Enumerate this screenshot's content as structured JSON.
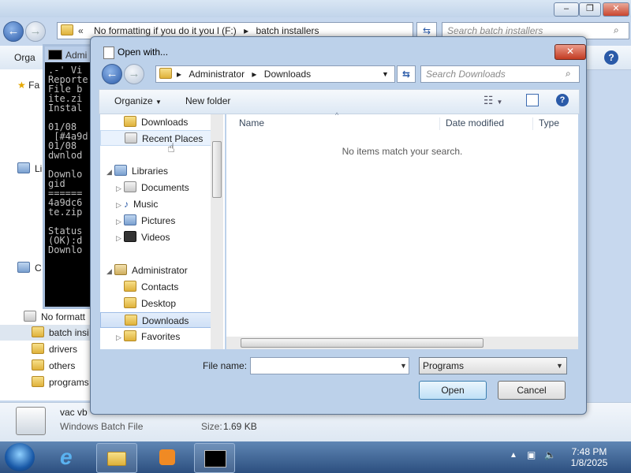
{
  "background_window": {
    "address_path": [
      "No formatting if you do it you l (F:)",
      "batch installers"
    ],
    "search_placeholder": "Search batch installers",
    "toolbar_organize": "Orga",
    "left_tree": [
      {
        "label": "Fa"
      },
      {
        "label": "Li"
      },
      {
        "label": "C"
      },
      {
        "label": "No formatt"
      },
      {
        "label": "batch insi"
      },
      {
        "label": "drivers"
      },
      {
        "label": "others"
      },
      {
        "label": "programs"
      }
    ],
    "details": {
      "filename": "vac vb",
      "type": "Windows Batch File",
      "size_label": "Size:",
      "size_value": "1.69 KB"
    }
  },
  "console_window": {
    "title": "Admi",
    "lines": [
      ".-' Vi",
      "Reporte",
      "File b",
      "ite.zi",
      "Instal",
      "",
      "01/08 ",
      " [#4a9d",
      "01/08 ",
      "dwnlod",
      "",
      "Downlo",
      "gid",
      "======",
      "4a9dc6",
      "te.zip",
      "",
      "Status",
      "(OK):d",
      "Downlo"
    ]
  },
  "dialog": {
    "title": "Open with...",
    "close_glyph": "✕",
    "address_path": [
      "Administrator",
      "Downloads"
    ],
    "search_placeholder": "Search Downloads",
    "toolbar": {
      "organize": "Organize",
      "new_folder": "New folder"
    },
    "nav_items": [
      {
        "label": "Downloads",
        "icon": "folder"
      },
      {
        "label": "Recent Places",
        "icon": "recent-places"
      },
      {
        "label": "Libraries",
        "icon": "library"
      },
      {
        "label": "Documents",
        "icon": "documents"
      },
      {
        "label": "Music",
        "icon": "music"
      },
      {
        "label": "Pictures",
        "icon": "pictures"
      },
      {
        "label": "Videos",
        "icon": "videos"
      },
      {
        "label": "Administrator",
        "icon": "user-folder"
      },
      {
        "label": "Contacts",
        "icon": "contacts"
      },
      {
        "label": "Desktop",
        "icon": "desktop"
      },
      {
        "label": "Downloads",
        "icon": "folder"
      },
      {
        "label": "Favorites",
        "icon": "favorites"
      }
    ],
    "columns": [
      "Name",
      "Date modified",
      "Type"
    ],
    "empty_message": "No items match your search.",
    "file_name_label": "File name:",
    "file_name_value": "",
    "file_type_value": "Programs",
    "open_label": "Open",
    "cancel_label": "Cancel"
  },
  "taskbar": {
    "time": "7:48 PM",
    "date": "1/8/2025"
  },
  "colors": {
    "dialog_frame": "#bcd1ea",
    "selection": "#cfe0f6",
    "taskbar": "#2c4f7f"
  }
}
